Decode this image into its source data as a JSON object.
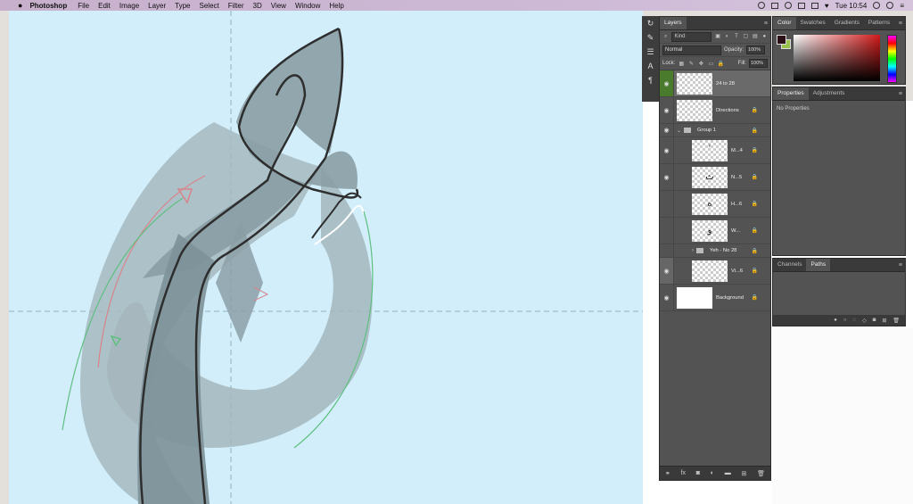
{
  "menubar": {
    "apple": "",
    "app": "Photoshop",
    "items": [
      "File",
      "Edit",
      "Image",
      "Layer",
      "Type",
      "Select",
      "Filter",
      "3D",
      "View",
      "Window",
      "Help"
    ],
    "clock": "Tue 10:54"
  },
  "layers_panel": {
    "tab": "Layers",
    "kind": "Kind",
    "blend_mode": "Normal",
    "opacity_label": "Opacity:",
    "opacity": "100%",
    "lock_label": "Lock:",
    "fill_label": "Fill:",
    "fill": "100%",
    "layers": [
      {
        "name": "24 to 28",
        "selected": true
      },
      {
        "name": "Directions"
      },
      {
        "name": "Group 1"
      },
      {
        "name": "M...4",
        "glyph": "ٴ"
      },
      {
        "name": "N...5",
        "glyph": "ث"
      },
      {
        "name": "H...6",
        "glyph": "ه"
      },
      {
        "name": "W...",
        "glyph": "و"
      },
      {
        "name": "Yeh - No 28"
      },
      {
        "name": "Vi...6"
      },
      {
        "name": "Background"
      }
    ],
    "footer_icons": [
      "link-icon",
      "fx-icon",
      "mask-icon",
      "adjustment-icon",
      "folder-icon",
      "new-layer-icon",
      "trash-icon"
    ]
  },
  "color_panel": {
    "tabs": [
      "Color",
      "Swatches",
      "Gradients",
      "Patterns"
    ],
    "foreground": "#2b1018",
    "background": "#97c14c"
  },
  "properties_panel": {
    "tabs": [
      "Properties",
      "Adjustments"
    ],
    "body": "No Properties"
  },
  "paths_panel": {
    "tabs": [
      "Channels",
      "Paths"
    ]
  },
  "colors": {
    "artboard": "#d1eefa",
    "panel": "#535353"
  }
}
